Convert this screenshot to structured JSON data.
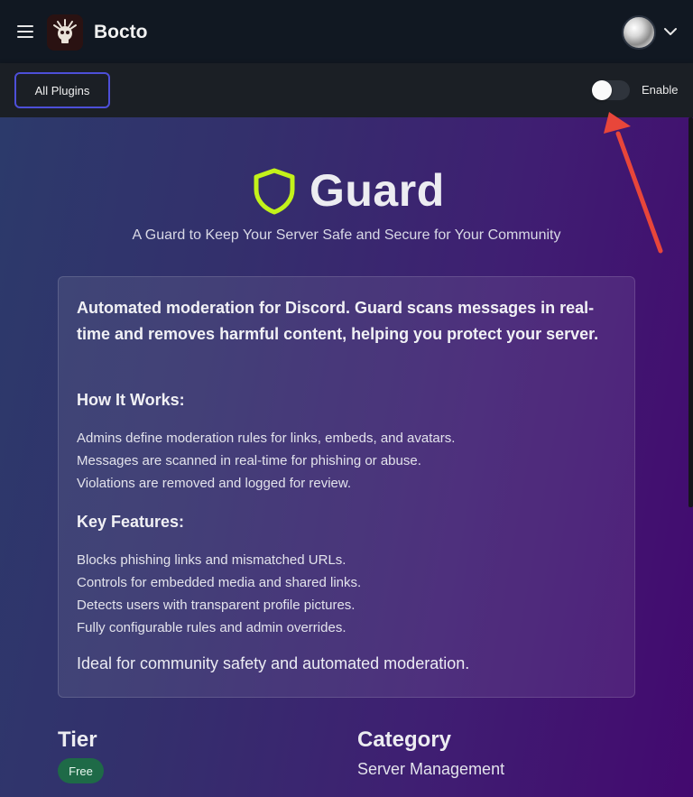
{
  "header": {
    "brand": "Bocto",
    "menu_icon": "hamburger-icon",
    "user_avatar": "avatar",
    "user_menu_icon": "chevron-down-icon"
  },
  "toolbar": {
    "all_plugins_label": "All Plugins",
    "toggle_label": "Enable",
    "toggle_enabled": false
  },
  "plugin": {
    "icon": "shield-icon",
    "icon_color": "#c3f21a",
    "name": "Guard",
    "tagline": "A Guard to Keep Your Server Safe and Secure for Your Community",
    "description": {
      "lead": "Automated moderation for Discord. Guard scans messages in real-time and removes harmful content, helping you protect your server.",
      "how_title": "How It Works:",
      "how_items": [
        "Admins define moderation rules for links, embeds, and avatars.",
        "Messages are scanned in real-time for phishing or abuse.",
        "Violations are removed and logged for review."
      ],
      "features_title": "Key Features:",
      "features_items": [
        "Blocks phishing links and mismatched URLs.",
        "Controls for embedded media and shared links.",
        "Detects users with transparent profile pictures.",
        "Fully configurable rules and admin overrides."
      ],
      "closing": "Ideal for community safety and automated moderation."
    },
    "tier_label": "Tier",
    "tier_value": "Free",
    "tier_color": "#1e6a47",
    "category_label": "Category",
    "category_value": "Server Management"
  },
  "annotation": {
    "arrow_color": "#e8463a"
  }
}
